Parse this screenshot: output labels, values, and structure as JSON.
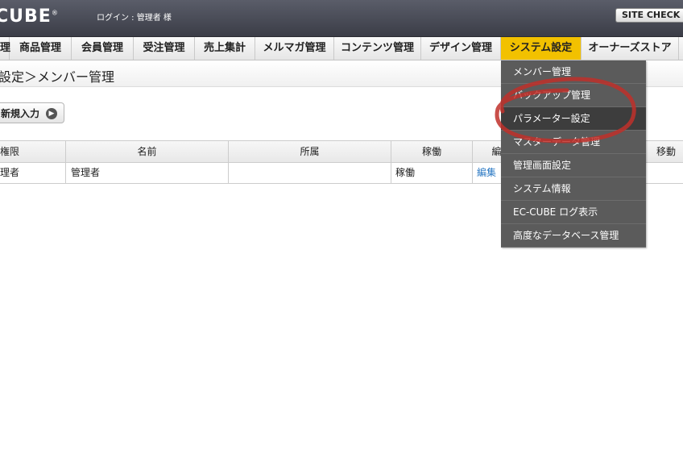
{
  "header": {
    "logo": "CUBE",
    "logo_mark": "®",
    "login_text": "ログイン : 管理者 様",
    "site_check": "SITE CHECK"
  },
  "nav": {
    "items": [
      {
        "label": "理"
      },
      {
        "label": "商品管理"
      },
      {
        "label": "会員管理"
      },
      {
        "label": "受注管理"
      },
      {
        "label": "売上集計"
      },
      {
        "label": "メルマガ管理"
      },
      {
        "label": "コンテンツ管理"
      },
      {
        "label": "デザイン管理"
      },
      {
        "label": "システム設定"
      },
      {
        "label": "オーナーズストア"
      }
    ],
    "active_index": 8,
    "active_color": "#f2c100"
  },
  "page": {
    "title": "設定＞メンバー管理",
    "new_button": "新規入力",
    "new_button_icon": "arrow-right-circle-icon"
  },
  "table": {
    "headers": [
      "権限",
      "名前",
      "所属",
      "稼働",
      "編",
      "移動"
    ],
    "rows": [
      {
        "authority": "理者",
        "name": "管理者",
        "dept": "",
        "status": "稼働",
        "edit": "編集"
      }
    ]
  },
  "dropdown": {
    "items": [
      {
        "label": "メンバー管理"
      },
      {
        "label": "バックアップ管理"
      },
      {
        "label": "パラメーター設定"
      },
      {
        "label": "マスターデータ管理"
      },
      {
        "label": "管理画面設定"
      },
      {
        "label": "システム情報"
      },
      {
        "label": "EC-CUBE ログ表示"
      },
      {
        "label": "高度なデータベース管理"
      }
    ],
    "hovered_index": 2,
    "bg_color": "#5b5b5b",
    "hover_color": "#3d3d3d"
  },
  "annotation": {
    "shape": "ellipse",
    "color": "#c0302a"
  }
}
